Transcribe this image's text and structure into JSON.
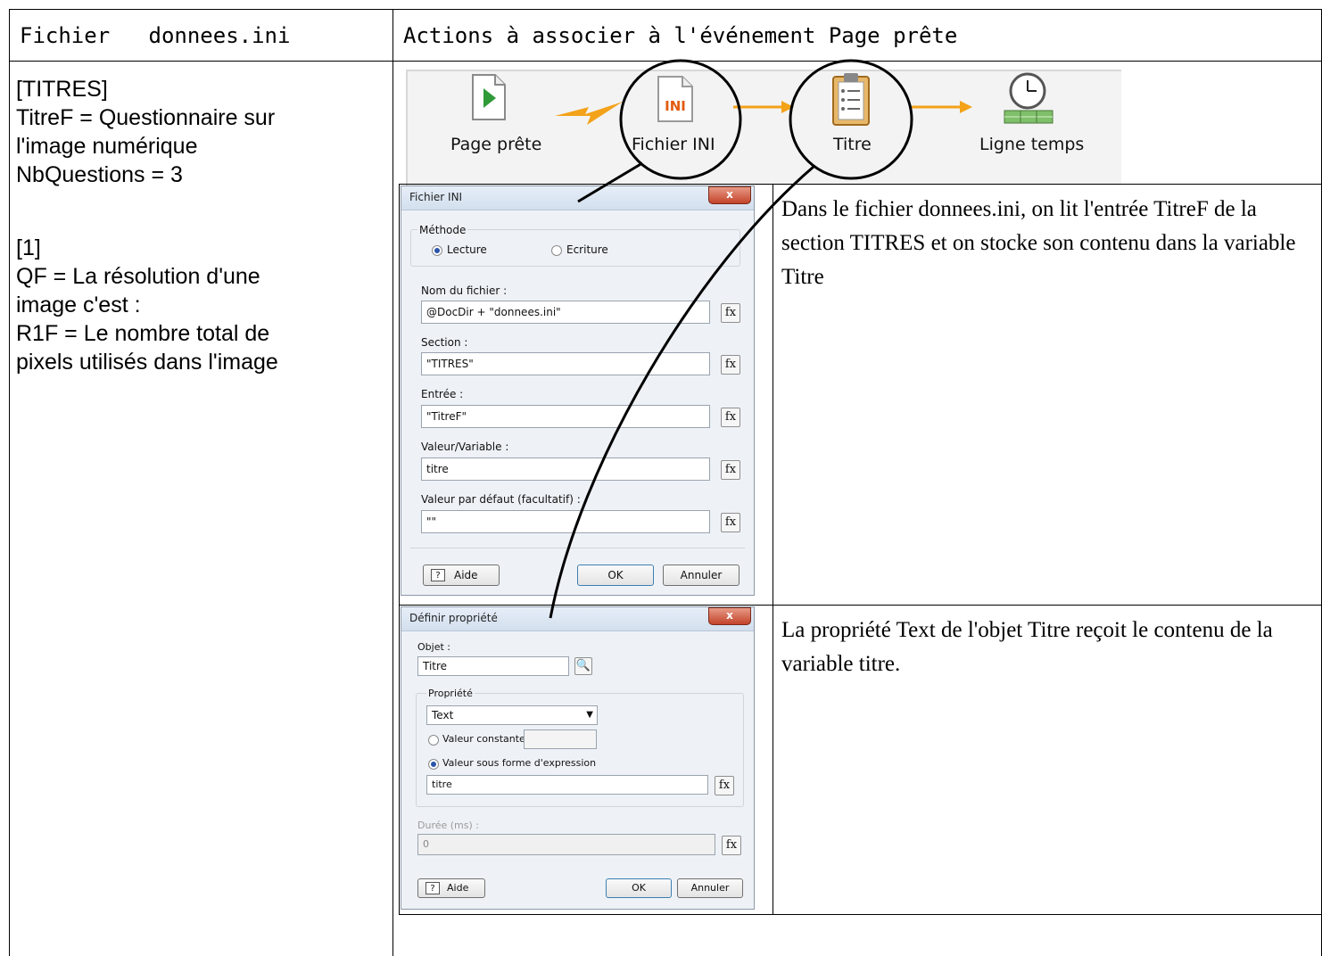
{
  "table": {
    "header_left": "Fichier   donnees.ini",
    "header_right": "Actions à associer à l'événement Page prête"
  },
  "ini_file": {
    "lines": [
      "[TITRES]",
      "TitreF = Questionnaire sur",
      "l'image numérique",
      "NbQuestions = 3",
      "",
      "[1]",
      "QF = La résolution d'une",
      "image c'est :",
      "R1F = Le nombre total de",
      "pixels utilisés dans l'image"
    ]
  },
  "toolbar": {
    "items": [
      {
        "label": "Page prête",
        "icon": "page-play-icon"
      },
      {
        "label": "Fichier INI",
        "icon": "ini-file-icon"
      },
      {
        "label": "Titre",
        "icon": "clipboard-list-icon"
      },
      {
        "label": "Ligne temps",
        "icon": "clock-timeline-icon"
      }
    ]
  },
  "dialog_ini": {
    "title": "Fichier INI",
    "close": "x",
    "method_label": "Méthode",
    "radio_read": "Lecture",
    "radio_write": "Ecriture",
    "selected": "Lecture",
    "filename_label": "Nom du fichier :",
    "filename_value": "@DocDir + \"donnees.ini\"",
    "section_label": "Section :",
    "section_value": "\"TITRES\"",
    "entry_label": "Entrée :",
    "entry_value": "\"TitreF\"",
    "var_label": "Valeur/Variable :",
    "var_value": "titre",
    "default_label": "Valeur par défaut (facultatif) :",
    "default_value": "\"\"",
    "fx": "fx",
    "help": "Aide",
    "ok": "OK",
    "cancel": "Annuler"
  },
  "desc_ini": "Dans le fichier donnees.ini, on lit l'entrée TitreF de la section TITRES et on stocke son contenu dans la variable Titre",
  "dialog_prop": {
    "title": "Définir propriété",
    "close": "x",
    "object_label": "Objet :",
    "object_value": "Titre",
    "property_label": "Propriété",
    "property_value": "Text",
    "radio_const": "Valeur constante",
    "radio_expr": "Valeur sous forme d'expression",
    "selected": "Valeur sous forme d'expression",
    "expr_value": "titre",
    "duration_label": "Durée (ms) :",
    "duration_value": "0",
    "fx": "fx",
    "help": "Aide",
    "ok": "OK",
    "cancel": "Annuler"
  },
  "desc_prop": "La propriété Text de l'objet Titre reçoit le contenu de la variable titre."
}
